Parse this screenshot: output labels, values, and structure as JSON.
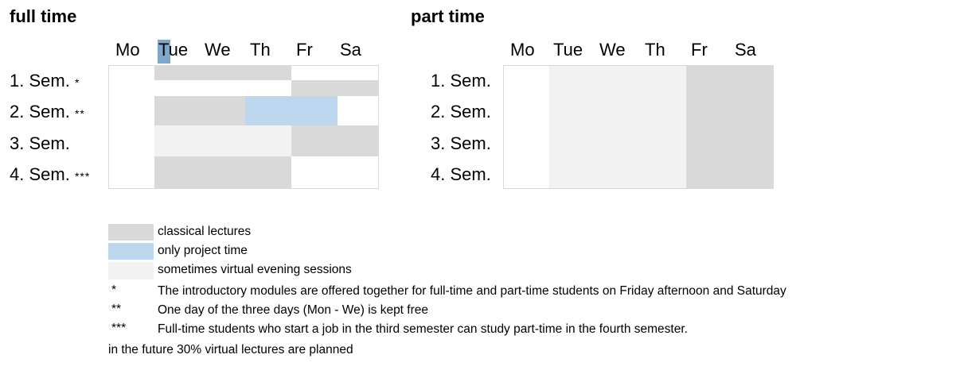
{
  "full_time": {
    "title": "full time",
    "days": [
      "Mo",
      "Tue",
      "We",
      "Th",
      "Fr",
      "Sa"
    ],
    "rows": [
      {
        "label": "1. Sem.",
        "mark": "*"
      },
      {
        "label": "2. Sem.",
        "mark": "**"
      },
      {
        "label": "3. Sem.",
        "mark": ""
      },
      {
        "label": "4. Sem.",
        "mark": "***"
      }
    ]
  },
  "part_time": {
    "title": "part time",
    "days": [
      "Mo",
      "Tue",
      "We",
      "Th",
      "Fr",
      "Sa"
    ],
    "rows": [
      {
        "label": "1. Sem."
      },
      {
        "label": "2. Sem."
      },
      {
        "label": "3. Sem."
      },
      {
        "label": "4. Sem."
      }
    ]
  },
  "legend": {
    "classical": "classical lectures",
    "project": "only project time",
    "evening": "sometimes virtual evening sessions"
  },
  "notes": [
    {
      "mark": "*",
      "text": "The introductory modules are offered together for full-time and part-time students on Friday afternoon and Saturday"
    },
    {
      "mark": "**",
      "text": "One day of the three days (Mon - We) is kept free"
    },
    {
      "mark": "***",
      "text": "Full-time students who start a job in the third semester can study part-time in the fourth semester."
    }
  ],
  "footer": "in the future 30% virtual lectures are planned",
  "colors": {
    "classical": "#d9d9d9",
    "project": "#bdd7ee",
    "evening": "#f2f2f2",
    "highlight": "#7fa7c9"
  }
}
